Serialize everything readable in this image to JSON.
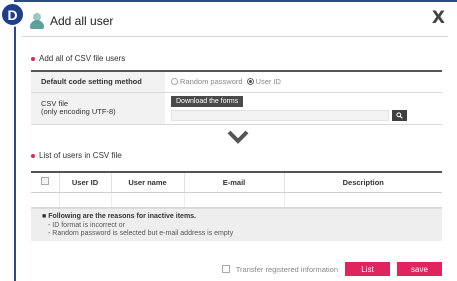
{
  "step_badge": "D",
  "dialog": {
    "title": "Add all user",
    "close_label": "X"
  },
  "csv_section": {
    "heading": "Add all of CSV file users",
    "code_setting_label": "Default code setting method",
    "options": [
      {
        "label": "Random password",
        "selected": false
      },
      {
        "label": "User ID",
        "selected": true
      }
    ],
    "csv_file_label": "CSV file",
    "csv_file_sublabel": "(only encoding UTF-8)",
    "download_button": "Download the forms",
    "file_value": ""
  },
  "list_section": {
    "heading": "List of users in CSV file",
    "columns": [
      "User ID",
      "User name",
      "E-mail",
      "Description"
    ]
  },
  "notice": {
    "title": "Following are the reasons for inactive items.",
    "items": [
      "ID format is incorrect or",
      "Random password is selected but e-mail address is empty"
    ]
  },
  "footer": {
    "transfer_label": "Transfer registered information",
    "list_button": "List",
    "save_button": "save"
  },
  "colors": {
    "accent": "#e0245e",
    "badge": "#1f3f8a",
    "dark_button": "#4a4a4a"
  }
}
